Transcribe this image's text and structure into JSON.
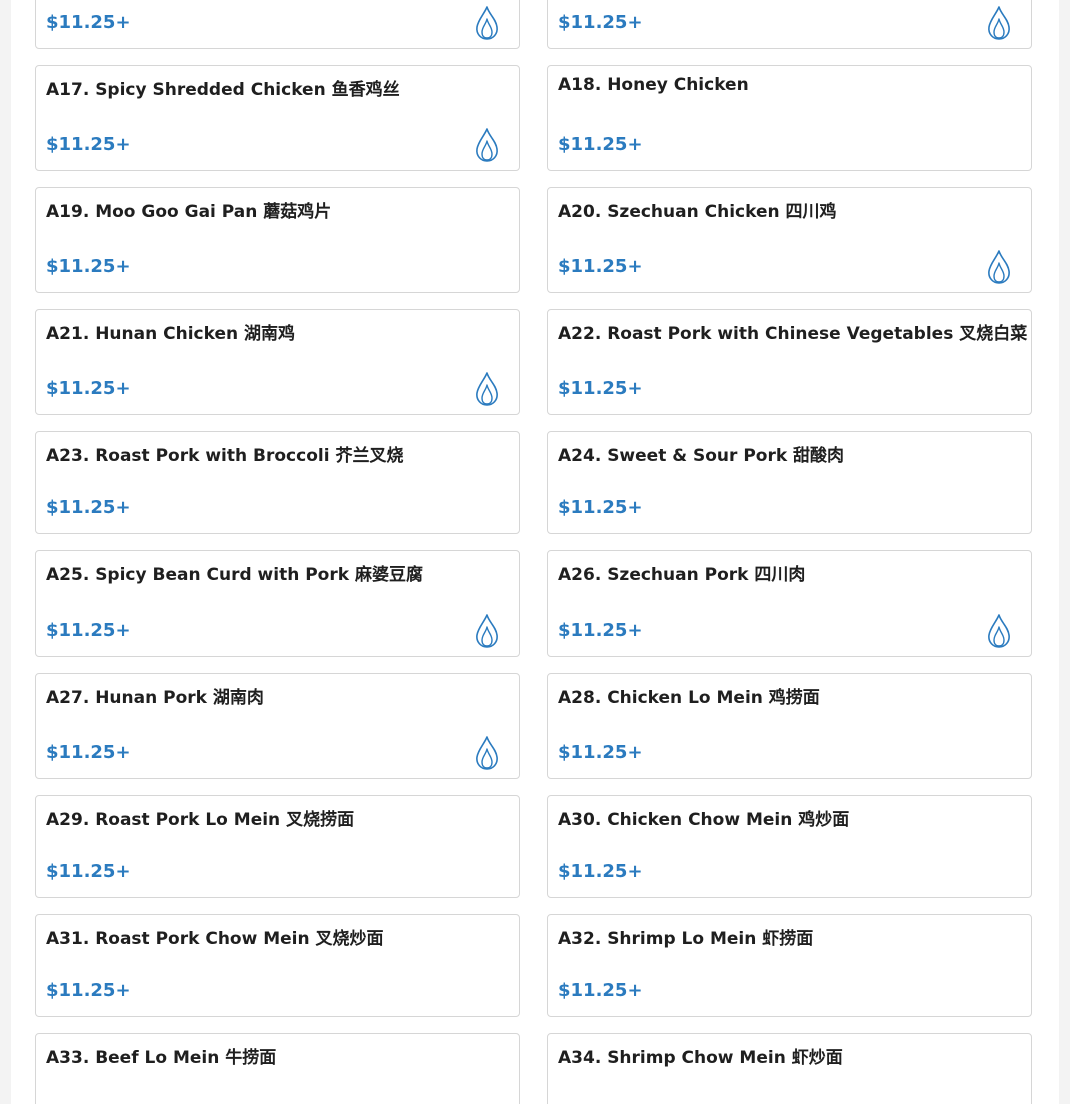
{
  "colors": {
    "price": "#2b7bbf",
    "spicy_icon": "#2b7bbf",
    "item_name": "#1f1f1f",
    "card_border": "#d6d6d6"
  },
  "menu_items": [
    {
      "name": "",
      "price": "$11.25+",
      "spicy": true
    },
    {
      "name": "",
      "price": "$11.25+",
      "spicy": true
    },
    {
      "name": "A17. Spicy Shredded Chicken 鱼香鸡丝",
      "price": "$11.25+",
      "spicy": true
    },
    {
      "name": "A18. Honey Chicken",
      "price": "$11.25+",
      "spicy": false
    },
    {
      "name": "A19. Moo Goo Gai Pan 蘑菇鸡片",
      "price": "$11.25+",
      "spicy": false
    },
    {
      "name": "A20. Szechuan Chicken 四川鸡",
      "price": "$11.25+",
      "spicy": true
    },
    {
      "name": "A21. Hunan Chicken 湖南鸡",
      "price": "$11.25+",
      "spicy": true
    },
    {
      "name": "A22. Roast Pork with Chinese Vegetables 叉烧白菜",
      "price": "$11.25+",
      "spicy": false
    },
    {
      "name": "A23. Roast Pork with Broccoli 芥兰叉烧",
      "price": "$11.25+",
      "spicy": false
    },
    {
      "name": "A24. Sweet & Sour Pork 甜酸肉",
      "price": "$11.25+",
      "spicy": false
    },
    {
      "name": "A25. Spicy Bean Curd with Pork 麻婆豆腐",
      "price": "$11.25+",
      "spicy": true
    },
    {
      "name": "A26. Szechuan Pork 四川肉",
      "price": "$11.25+",
      "spicy": true
    },
    {
      "name": "A27. Hunan Pork 湖南肉",
      "price": "$11.25+",
      "spicy": true
    },
    {
      "name": "A28. Chicken Lo Mein 鸡捞面",
      "price": "$11.25+",
      "spicy": false
    },
    {
      "name": "A29. Roast Pork Lo Mein 叉烧捞面",
      "price": "$11.25+",
      "spicy": false
    },
    {
      "name": "A30. Chicken Chow Mein 鸡炒面",
      "price": "$11.25+",
      "spicy": false
    },
    {
      "name": "A31. Roast Pork Chow Mein 叉烧炒面",
      "price": "$11.25+",
      "spicy": false
    },
    {
      "name": "A32. Shrimp Lo Mein 虾捞面",
      "price": "$11.25+",
      "spicy": false
    },
    {
      "name": "A33. Beef Lo Mein 牛捞面",
      "price": "",
      "spicy": false
    },
    {
      "name": "A34. Shrimp Chow Mein 虾炒面",
      "price": "",
      "spicy": false
    }
  ]
}
